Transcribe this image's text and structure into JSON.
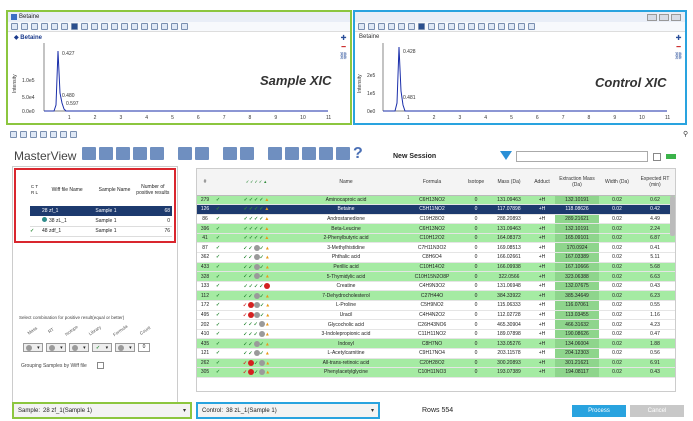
{
  "window": {
    "title": "Betaine"
  },
  "xic_left": {
    "label": "Sample XIC",
    "trace": "◆ Betaine",
    "y_ticks": [
      "1.0e5",
      "5.0e4",
      "0.0e0"
    ],
    "y_axis": "Intensity",
    "x_ticks": [
      "1",
      "2",
      "3",
      "4",
      "5",
      "6",
      "7",
      "8",
      "9",
      "10",
      "11"
    ],
    "x_axis": "Time, min",
    "peak_labels": [
      "0.427",
      "0.480",
      "0.597"
    ]
  },
  "xic_right": {
    "label": "Control XIC",
    "trace": "Betaine",
    "y_ticks": [
      "2e5",
      "1e5",
      "0e0"
    ],
    "y_axis": "Intensity",
    "x_ticks": [
      "1",
      "2",
      "3",
      "4",
      "5",
      "6",
      "7",
      "8",
      "9",
      "10",
      "11"
    ],
    "x_axis": "Time, min",
    "peak_labels": [
      "0.428",
      "0.481"
    ]
  },
  "masterview": {
    "title": "MasterView",
    "session": "New Session",
    "rows_label": "Rows 554",
    "process_label": "Process",
    "cancel_label": "Cancel"
  },
  "sample_table": {
    "headers": [
      "C T R L",
      "Wiff file Name",
      "Sample Name",
      "Number of positive results"
    ],
    "rows": [
      {
        "ctrl": "",
        "wiff": "28 zf_1",
        "sample": "Sample 1",
        "count": "68"
      },
      {
        "ctrl": "",
        "wiff": "38 zL_1",
        "sample": "Sample 1",
        "count": "0"
      },
      {
        "ctrl": "✓",
        "wiff": "48 zdf_1",
        "sample": "Sample 1",
        "count": "76"
      }
    ]
  },
  "filter_panel": {
    "caption": "Select combination for positive result(equal or better)",
    "filter_labels": [
      "Mass",
      "RT",
      "Isotope",
      "Library",
      "Formula",
      "Count"
    ],
    "grouping_label": "Grouping Samples by Wiff file"
  },
  "grid": {
    "headers": [
      "#",
      "",
      "",
      "Name",
      "Formula",
      "Isotope",
      "Mass (Da)",
      "Adduct",
      "Extraction Mass (Da)",
      "Width (Da)",
      "Expected RT (min)"
    ],
    "rows": [
      {
        "n": "279",
        "name": "Aminocaproic acid",
        "formula": "C6H13NO2",
        "iso": "0",
        "mass": "131.09463",
        "adduct": "+H",
        "ext": "132.10191",
        "width": "0.02",
        "rt": "0.62",
        "style": "g",
        "icons": "cccct"
      },
      {
        "n": "126",
        "name": "Betaine",
        "formula": "C5H11NO2",
        "iso": "0",
        "mass": "117.07898",
        "adduct": "+H",
        "ext": "118.08626",
        "width": "0.02",
        "rt": "0.42",
        "style": "sel",
        "icons": "cccct"
      },
      {
        "n": "86",
        "name": "Androstanedione",
        "formula": "C19H28O2",
        "iso": "0",
        "mass": "288.20893",
        "adduct": "+H",
        "ext": "289.21621",
        "width": "0.02",
        "rt": "4.49",
        "style": "w",
        "icons": "cccct"
      },
      {
        "n": "396",
        "name": "Beta-Leucine",
        "formula": "C6H13NO2",
        "iso": "0",
        "mass": "131.09463",
        "adduct": "+H",
        "ext": "132.10191",
        "width": "0.02",
        "rt": "2.24",
        "style": "g",
        "icons": "cccct"
      },
      {
        "n": "41",
        "name": "2-Phenylbutyric acid",
        "formula": "C10H12O2",
        "iso": "0",
        "mass": "164.08373",
        "adduct": "+H",
        "ext": "165.09101",
        "width": "0.02",
        "rt": "6.87",
        "style": "g",
        "icons": "cccct"
      },
      {
        "n": "87",
        "name": "3-Methylhistidine",
        "formula": "C7H11N3O2",
        "iso": "0",
        "mass": "169.08513",
        "adduct": "+H",
        "ext": "170.0924",
        "width": "0.02",
        "rt": "0.41",
        "style": "w",
        "icons": "ccgct"
      },
      {
        "n": "362",
        "name": "Phthalic acid",
        "formula": "C8H6O4",
        "iso": "0",
        "mass": "166.02661",
        "adduct": "+H",
        "ext": "167.03389",
        "width": "0.02",
        "rt": "5.11",
        "style": "w",
        "icons": "ccgct"
      },
      {
        "n": "433",
        "name": "Perillic acid",
        "formula": "C10H14O2",
        "iso": "0",
        "mass": "166.09938",
        "adduct": "+H",
        "ext": "167.10666",
        "width": "0.02",
        "rt": "5.68",
        "style": "g",
        "icons": "ccgct"
      },
      {
        "n": "328",
        "name": "5-Thymidylic acid",
        "formula": "C10H15N2O8P",
        "iso": "0",
        "mass": "322.0566",
        "adduct": "+H",
        "ext": "323.06388",
        "width": "0.02",
        "rt": "6.63",
        "style": "g",
        "icons": "ccgct"
      },
      {
        "n": "133",
        "name": "Creatine",
        "formula": "C4H9N3O2",
        "iso": "0",
        "mass": "131.06948",
        "adduct": "+H",
        "ext": "132.07675",
        "width": "0.02",
        "rt": "0.43",
        "style": "w",
        "icons": "ccccr"
      },
      {
        "n": "112",
        "name": "7-Dehydrocholesterol",
        "formula": "C27H44O",
        "iso": "0",
        "mass": "384.33922",
        "adduct": "+H",
        "ext": "385.34649",
        "width": "0.02",
        "rt": "6.23",
        "style": "g",
        "icons": "ccgct"
      },
      {
        "n": "172",
        "name": "L-Proline",
        "formula": "C5H9NO2",
        "iso": "0",
        "mass": "115.06333",
        "adduct": "+H",
        "ext": "116.07061",
        "width": "0.02",
        "rt": "0.55",
        "style": "w",
        "icons": "xrgct"
      },
      {
        "n": "495",
        "name": "Uracil",
        "formula": "C4H4N2O2",
        "iso": "0",
        "mass": "112.02728",
        "adduct": "+H",
        "ext": "113.03455",
        "width": "0.02",
        "rt": "1.16",
        "style": "w",
        "icons": "xrgct"
      },
      {
        "n": "202",
        "name": "Glycocholic acid",
        "formula": "C26H43NO6",
        "iso": "0",
        "mass": "465.30904",
        "adduct": "+H",
        "ext": "466.31632",
        "width": "0.02",
        "rt": "4.23",
        "style": "w",
        "icons": "cccgt"
      },
      {
        "n": "410",
        "name": "3-Indolepropionic acid",
        "formula": "C11H11NO2",
        "iso": "0",
        "mass": "189.07898",
        "adduct": "+H",
        "ext": "190.08626",
        "width": "0.02",
        "rt": "0.47",
        "style": "w",
        "icons": "cccgt"
      },
      {
        "n": "435",
        "name": "Indoxyl",
        "formula": "C8H7NO",
        "iso": "0",
        "mass": "133.05276",
        "adduct": "+H",
        "ext": "134.06004",
        "width": "0.02",
        "rt": "1.88",
        "style": "g",
        "icons": "ccgct"
      },
      {
        "n": "121",
        "name": "L-Acetylcarnitine",
        "formula": "C9H17NO4",
        "iso": "0",
        "mass": "203.11578",
        "adduct": "+H",
        "ext": "204.12303",
        "width": "0.02",
        "rt": "0.56",
        "style": "w",
        "icons": "ccgct"
      },
      {
        "n": "262",
        "name": "All-trans-retinoic acid",
        "formula": "C20H28O2",
        "iso": "0",
        "mass": "300.20893",
        "adduct": "+H",
        "ext": "301.21621",
        "width": "0.02",
        "rt": "6.91",
        "style": "g",
        "icons": "xrcgt"
      },
      {
        "n": "305",
        "name": "Phenylacetylglycine",
        "formula": "C10H11NO3",
        "iso": "0",
        "mass": "193.07389",
        "adduct": "+H",
        "ext": "194.08117",
        "width": "0.02",
        "rt": "0.43",
        "style": "g",
        "icons": "xrcgt"
      }
    ]
  },
  "bottom": {
    "sample_label": "Sample:",
    "sample_value": "28 zf_1(Sample 1)",
    "control_label": "Control:",
    "control_value": "38 zL_1(Sample 1)"
  },
  "colors": {
    "green_frame": "#8cc63f",
    "blue_frame": "#29a3df",
    "red_frame": "#d9262e",
    "selected_row": "#1d3a6e",
    "positive_row": "#a5eba3"
  }
}
